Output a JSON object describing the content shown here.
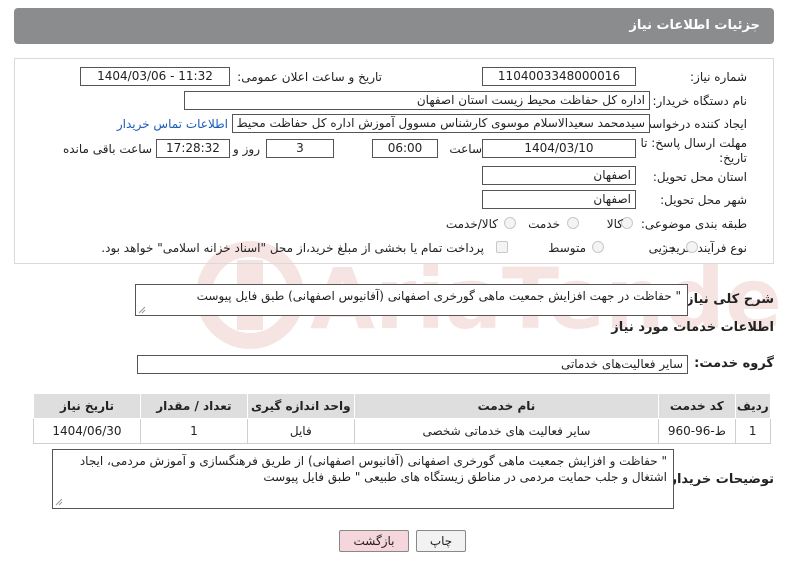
{
  "header": {
    "title": "جزئیات اطلاعات نیاز"
  },
  "form": {
    "need_number": {
      "label": "شماره نیاز:",
      "value": "1104003348000016"
    },
    "announce_datetime": {
      "label": "تاریخ و ساعت اعلان عمومی:",
      "value": "1404/03/06 - 11:32"
    },
    "buyer_org": {
      "label": "نام دستگاه خریدار:",
      "value": "اداره کل حفاظت محیط زیست استان اصفهان"
    },
    "requester": {
      "label": "ایجاد کننده درخواست:",
      "value": "سیدمحمد سعیدالاسلام موسوی کارشناس مسوول آموزش اداره کل حفاظت محیط زیست"
    },
    "contact_link": "اطلاعات تماس خریدار",
    "deadline": {
      "label_line1": "مهلت ارسال پاسخ: تا",
      "label_line2": "تاریخ:",
      "date": "1404/03/10",
      "time_label": "ساعت",
      "time": "06:00",
      "days": "3",
      "days_label": "روز و",
      "remaining_time": "17:28:32",
      "remaining_label": "ساعت باقی مانده"
    },
    "delivery_province": {
      "label": "استان محل تحویل:",
      "value": "اصفهان"
    },
    "delivery_city": {
      "label": "شهر محل تحویل:",
      "value": "اصفهان"
    },
    "category": {
      "label": "طبقه بندی موضوعی:",
      "options": [
        "کالا",
        "خدمت",
        "کالا/خدمت"
      ]
    },
    "purchase_type": {
      "label": "نوع فرآیند خرید :",
      "options": [
        "جزیی",
        "متوسط"
      ],
      "payment_note": "پرداخت تمام یا بخشی از مبلغ خرید،از محل \"اسناد خزانه اسلامی\" خواهد بود."
    }
  },
  "need_summary": {
    "label": "شرح کلی نیاز:",
    "value": "\" حفاظت در جهت افزایش جمعیت ماهی گورخری اصفهانی (آفانیوس اصفهانی) طبق فایل پیوست"
  },
  "services_section": {
    "title": "اطلاعات خدمات مورد نیاز"
  },
  "service_group": {
    "label": "گروه خدمت:",
    "value": "سایر فعالیت‌های خدماتی"
  },
  "table": {
    "headers": [
      "ردیف",
      "کد خدمت",
      "نام خدمت",
      "واحد اندازه گیری",
      "تعداد / مقدار",
      "تاریخ نیاز"
    ],
    "rows": [
      [
        "1",
        "ط-96-960",
        "سایر فعالیت های خدماتی شخصی",
        "فایل",
        "1",
        "1404/06/30"
      ]
    ]
  },
  "buyer_notes": {
    "label": "توضیحات خریدار:",
    "value": "\" حفاظت و افزایش جمعیت ماهی گورخری اصفهانی (آفانیوس اصفهانی) از طریق فرهنگسازی و آموزش مردمی، ایجاد اشتغال و جلب حمایت مردمی در مناطق زیستگاه های طبیعی \" طبق فایل پیوست"
  },
  "buttons": {
    "print": "چاپ",
    "back": "بازگشت"
  },
  "watermark": {
    "text": "AriaTender.neT"
  },
  "colors": {
    "header_bg": "#8a8c8e",
    "link": "#1a5bb8",
    "back_button_bg": "#f6d6dd",
    "watermark": "#c0392b"
  }
}
